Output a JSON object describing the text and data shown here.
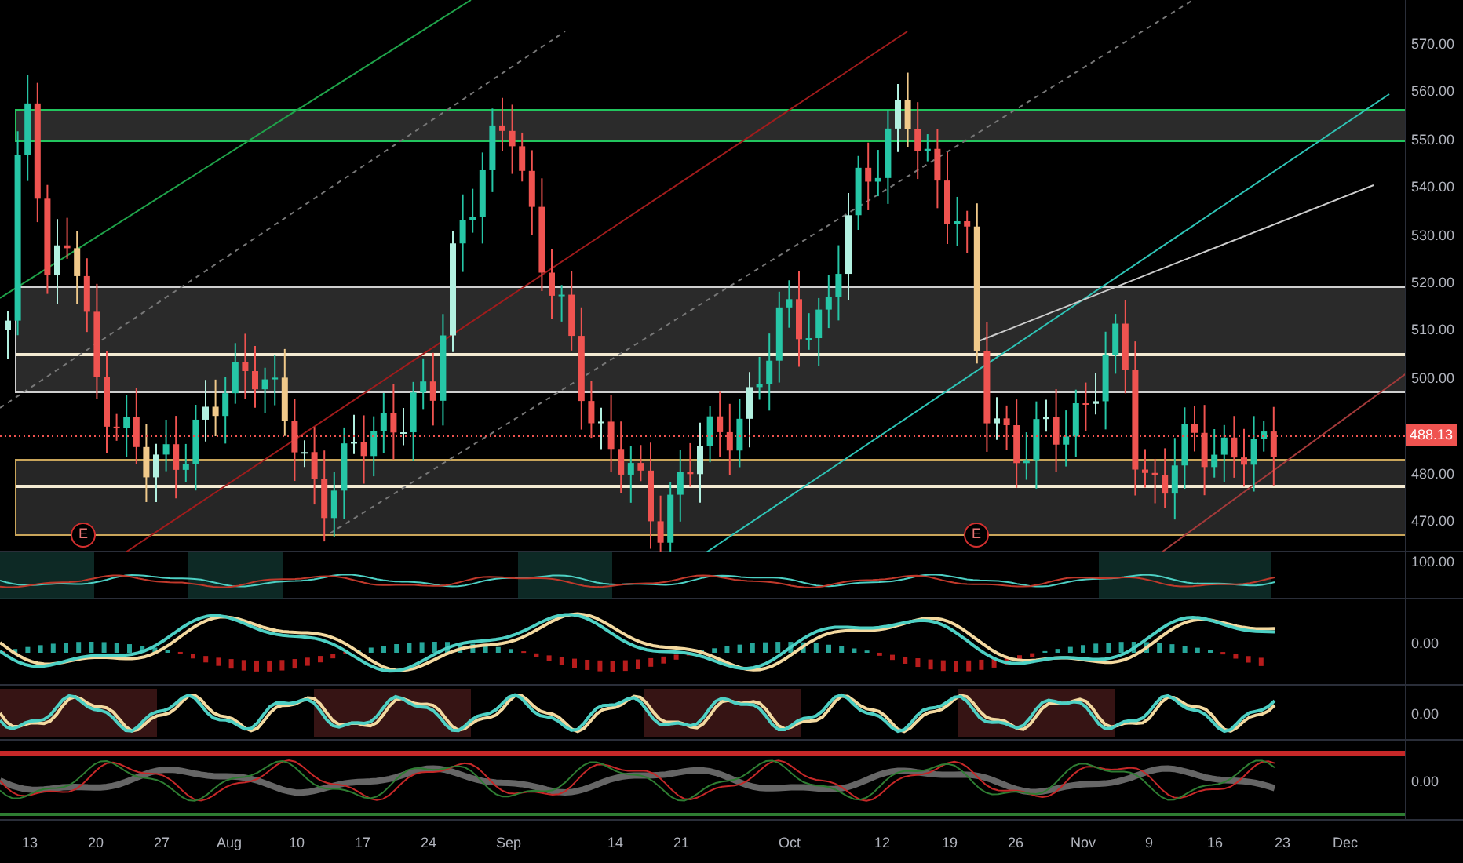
{
  "price_axis": {
    "labels": [
      "570.00",
      "560.00",
      "550.00",
      "540.00",
      "530.00",
      "520.00",
      "510.00",
      "500.00",
      "480.00",
      "470.00"
    ]
  },
  "price_tag": "488.13",
  "earnings_markers": [
    "E",
    "E"
  ],
  "indicator_axes": [
    "100.00",
    "0.00",
    "0.00",
    "0.00"
  ],
  "time_axis": {
    "labels": [
      "13",
      "20",
      "27",
      "Aug",
      "10",
      "17",
      "24",
      "Sep",
      "14",
      "21",
      "Oct",
      "12",
      "19",
      "26",
      "Nov",
      "9",
      "16",
      "23",
      "Dec"
    ]
  }
}
